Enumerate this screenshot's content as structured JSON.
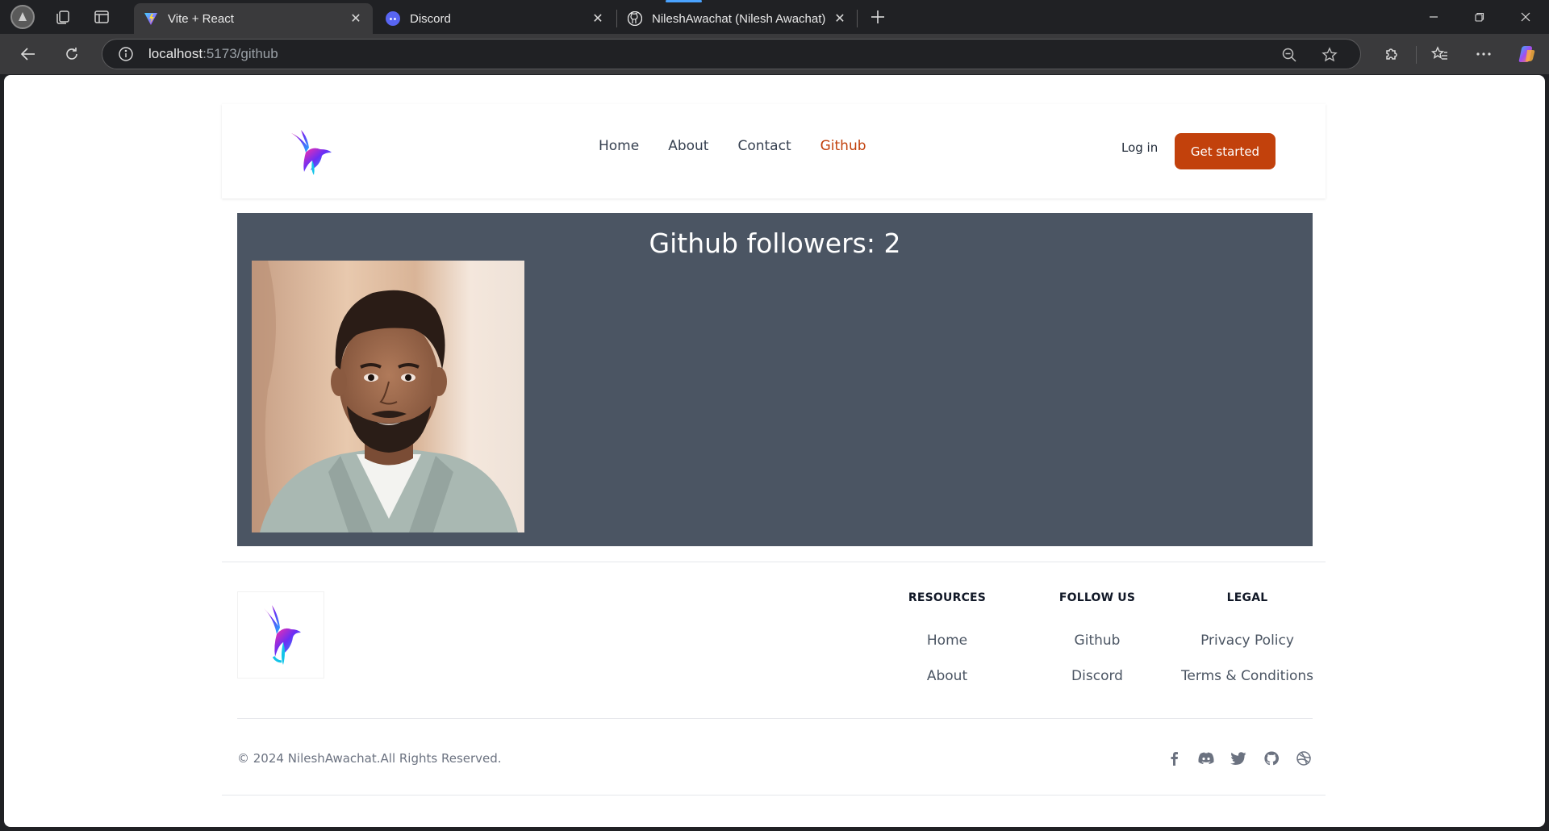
{
  "browser": {
    "tabs": [
      {
        "label": "Vite + React",
        "active": true,
        "favicon": "vite-icon"
      },
      {
        "label": "Discord",
        "active": false,
        "favicon": "discord-icon"
      },
      {
        "label": "NileshAwachat (Nilesh Awachat) · GitHub",
        "active": false,
        "favicon": "github-icon"
      }
    ],
    "url_host": "localhost",
    "url_rest": ":5173/github"
  },
  "header": {
    "nav": [
      "Home",
      "About",
      "Contact",
      "Github"
    ],
    "active_nav": "Github",
    "login_label": "Log in",
    "cta_label": "Get started"
  },
  "github": {
    "title": "Github followers: 2"
  },
  "footer": {
    "columns": [
      {
        "title": "RESOURCES",
        "links": [
          "Home",
          "About"
        ]
      },
      {
        "title": "FOLLOW US",
        "links": [
          "Github",
          "Discord"
        ]
      },
      {
        "title": "LEGAL",
        "links": [
          "Privacy Policy",
          "Terms & Conditions"
        ]
      }
    ],
    "copyright": "© 2024 NileshAwachat.All Rights Reserved.",
    "social_icons": [
      "facebook-icon",
      "discord-icon",
      "twitter-icon",
      "github-icon",
      "dribbble-icon"
    ]
  },
  "colors": {
    "accent": "#c2410c",
    "panel": "#4b5563"
  }
}
